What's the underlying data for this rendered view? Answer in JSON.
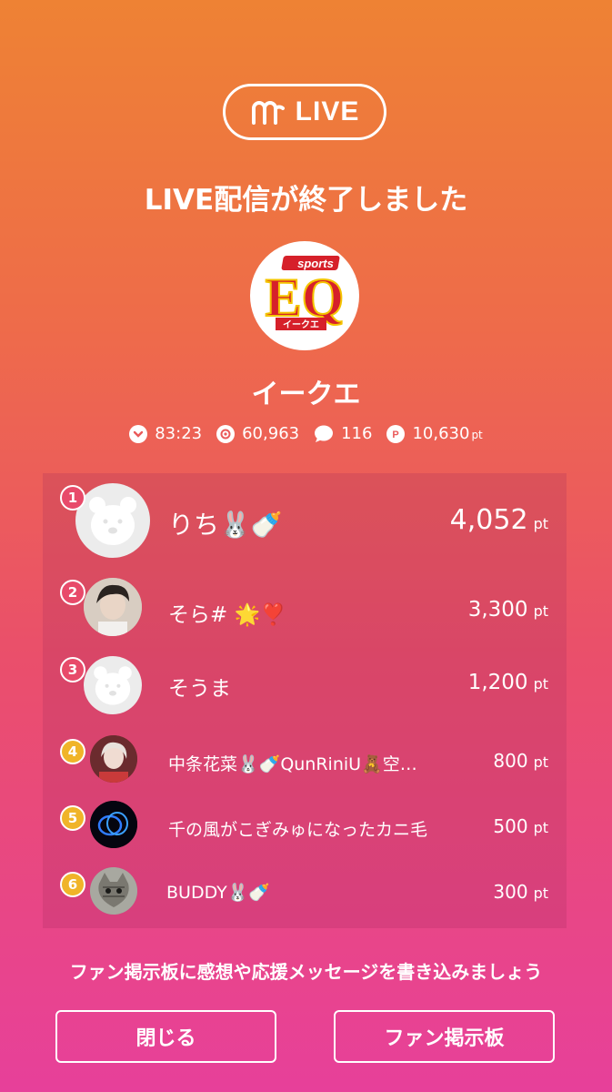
{
  "header": {
    "badge_label": "LIVE",
    "title": "LIVE配信が終了しました"
  },
  "channel": {
    "logo_top": "sports",
    "logo_main": "EQ",
    "logo_sub": "イークエ",
    "name": "イークエ"
  },
  "stats": {
    "duration": "83:23",
    "views": "60,963",
    "comments": "116",
    "points": "10,630",
    "points_unit": "pt"
  },
  "ranking": [
    {
      "rank": "1",
      "name": "りち🐰🍼",
      "points": "4,052",
      "unit": "pt",
      "badge_color": "#e84a6a"
    },
    {
      "rank": "2",
      "name": "そら# 🌟❣️",
      "points": "3,300",
      "unit": "pt",
      "badge_color": "#e84a6a"
    },
    {
      "rank": "3",
      "name": "そうま",
      "points": "1,200",
      "unit": "pt",
      "badge_color": "#e84a6a"
    },
    {
      "rank": "4",
      "name": "中条花菜🐰🍼QunRiniU🧸空…",
      "points": "800",
      "unit": "pt",
      "badge_color": "#f0b429"
    },
    {
      "rank": "5",
      "name": "千の風がこぎみゅになったカニ毛",
      "points": "500",
      "unit": "pt",
      "badge_color": "#f0b429"
    },
    {
      "rank": "6",
      "name": "BUDDY🐰🍼",
      "points": "300",
      "unit": "pt",
      "badge_color": "#f0b429"
    }
  ],
  "footer": {
    "message": "ファン掲示板に感想や応援メッセージを書き込みましょう",
    "close_label": "閉じる",
    "fanboard_label": "ファン掲示板"
  },
  "colors": {
    "top_gradient": "#ee8234",
    "bottom_gradient": "#e7409a",
    "top_rank_badge": "#e84a6a",
    "lower_rank_badge": "#f0b429",
    "logo_red": "#d6202a"
  }
}
